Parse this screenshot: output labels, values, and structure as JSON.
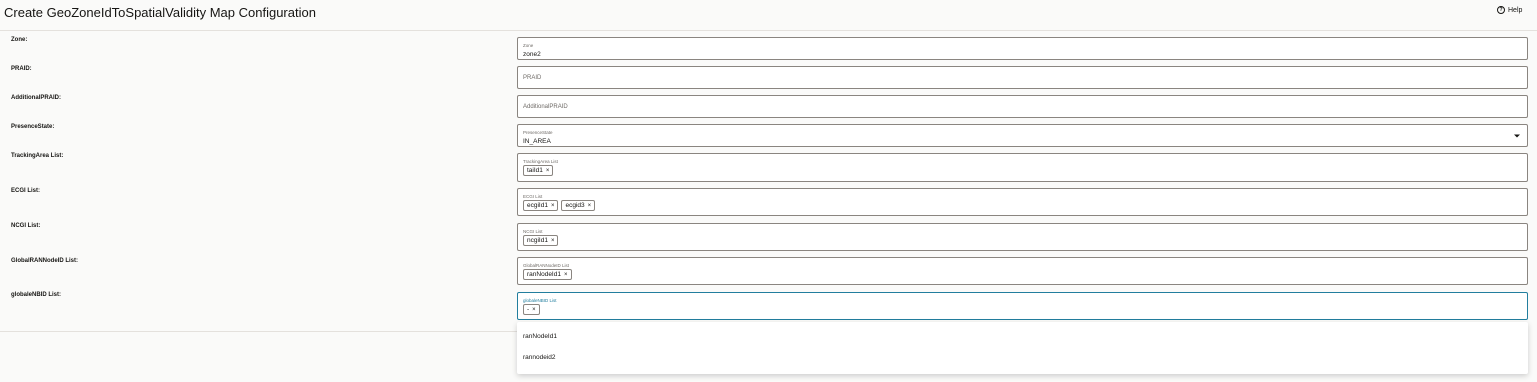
{
  "header": {
    "title": "Create GeoZoneIdToSpatialValidity Map Configuration",
    "help_label": "Help"
  },
  "form": {
    "zone": {
      "label": "Zone:",
      "field_label": "Zone",
      "value": "zone2"
    },
    "praid": {
      "label": "PRAID:",
      "placeholder": "PRAID"
    },
    "additional_praid": {
      "label": "AdditionalPRAID:",
      "placeholder": "AdditionalPRAID"
    },
    "presence_state": {
      "label": "PresenceState:",
      "field_label": "PresenceState",
      "value": "IN_AREA"
    },
    "tracking_area": {
      "label": "TrackingArea List:",
      "field_label": "TrackingArea List",
      "chips": [
        "taiId1"
      ]
    },
    "ecgi": {
      "label": "ECGI List:",
      "field_label": "ECGI List",
      "chips": [
        "ecgiId1",
        "ecgid3"
      ]
    },
    "ncgi": {
      "label": "NCGI List:",
      "field_label": "NCGI List",
      "chips": [
        "ncgiId1"
      ]
    },
    "global_ran": {
      "label": "GlobalRANNodeID List:",
      "field_label": "GlobalRANNodeID List",
      "chips": [
        "ranNodeId1"
      ]
    },
    "globale_nbid": {
      "label": "globaleNBID List:",
      "field_label": "globaleNBID List",
      "chips": [
        "-"
      ]
    }
  },
  "dropdown": {
    "options": [
      "ranNodeId1",
      "rannodeid2"
    ]
  },
  "chip_remove_glyph": "×"
}
